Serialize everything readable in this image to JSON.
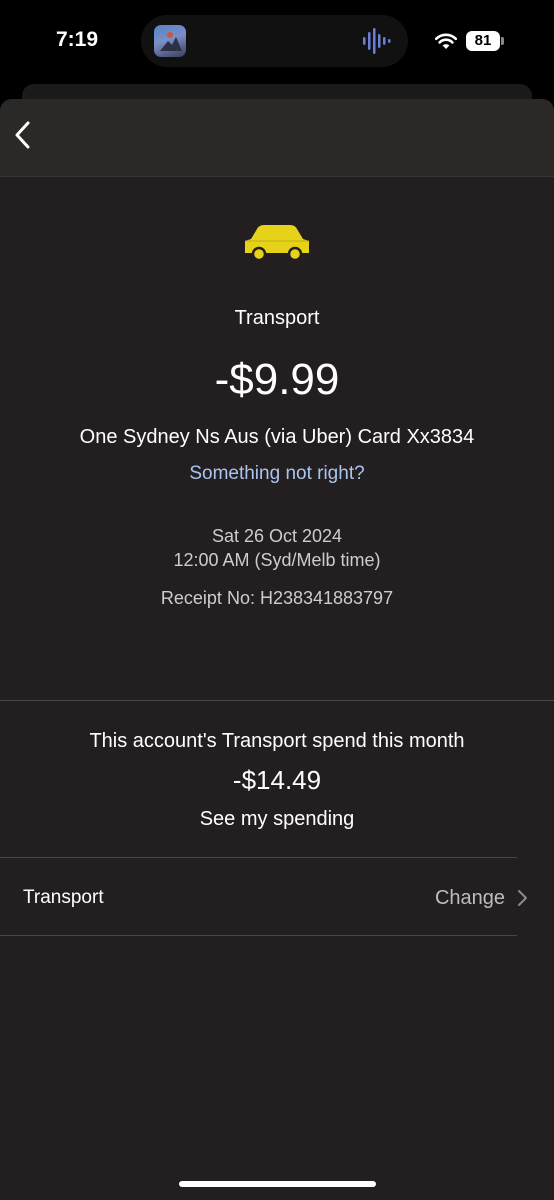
{
  "status_bar": {
    "time": "7:19",
    "battery": "81"
  },
  "transaction": {
    "category": "Transport",
    "amount": "-$9.99",
    "merchant": "One Sydney Ns Aus (via Uber) Card Xx3834",
    "report_link": "Something not right?",
    "date": "Sat 26 Oct 2024",
    "time": "12:00 AM (Syd/Melb time)",
    "receipt": "Receipt No: H238341883797",
    "category_icon": "car-icon",
    "icon_color": "#e6d219"
  },
  "spending": {
    "label": "This account's Transport spend this month",
    "amount": "-$14.49",
    "link": "See my spending"
  },
  "category_row": {
    "label": "Transport",
    "action": "Change"
  },
  "colors": {
    "background": "#231f20",
    "nav_bar": "#2b2828",
    "link": "#a9c4ee",
    "secondary_text": "#cfcccc"
  }
}
